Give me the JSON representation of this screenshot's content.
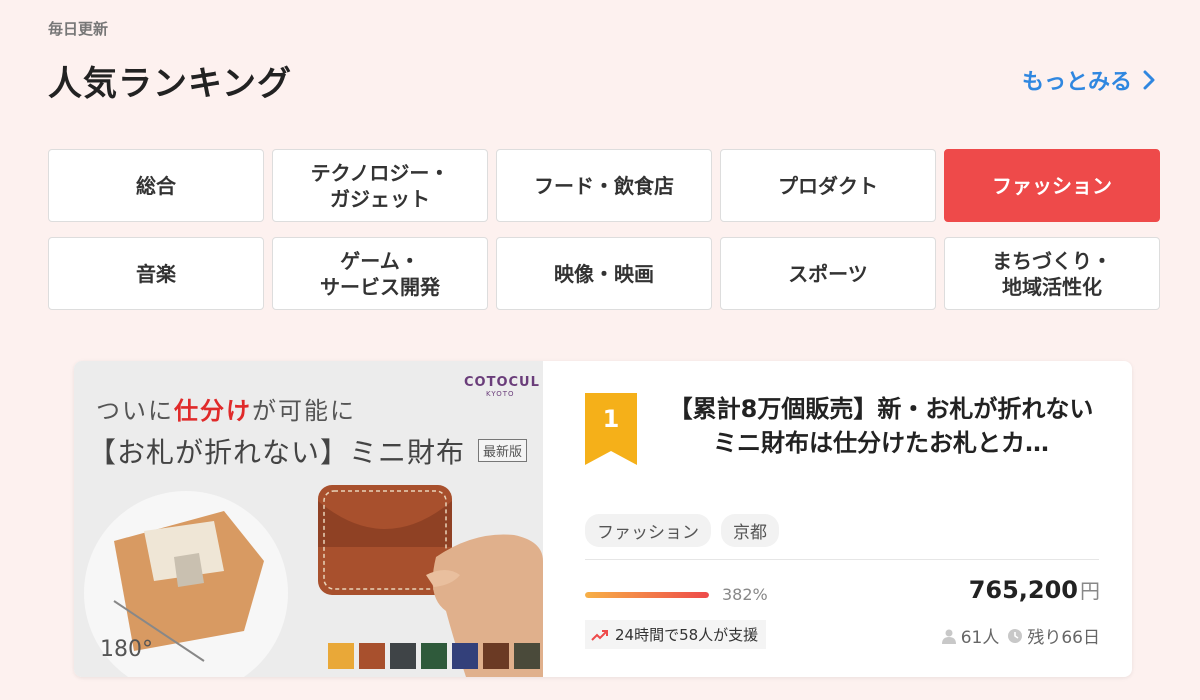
{
  "header": {
    "eyebrow": "毎日更新",
    "title": "人気ランキング",
    "more_label": "もっとみる"
  },
  "categories": [
    {
      "label": "総合",
      "active": false
    },
    {
      "label": "テクノロジー・\nガジェット",
      "active": false
    },
    {
      "label": "フード・飲食店",
      "active": false
    },
    {
      "label": "プロダクト",
      "active": false
    },
    {
      "label": "ファッション",
      "active": true
    },
    {
      "label": "音楽",
      "active": false
    },
    {
      "label": "ゲーム・\nサービス開発",
      "active": false
    },
    {
      "label": "映像・映画",
      "active": false
    },
    {
      "label": "スポーツ",
      "active": false
    },
    {
      "label": "まちづくり・\n地域活性化",
      "active": false
    }
  ],
  "project": {
    "rank": "1",
    "title": "【累計8万個販売】新・お札が折れないミニ財布は仕分けたお札とカ…",
    "tags": [
      "ファッション",
      "京都"
    ],
    "progress_percent": 382,
    "progress_label": "382%",
    "amount": "765,200",
    "currency_unit": "円",
    "trend_text": "24時間で58人が支援",
    "supporters": "61人",
    "remaining": "残り66日",
    "image": {
      "brand": "COTOCUL",
      "brand_sub": "KYOTO",
      "line1_pre": "ついに",
      "line1_hl": "仕分け",
      "line1_post": "が可能に",
      "line2": "【お札が折れない】ミニ財布",
      "badge": "最新版",
      "angle": "180°",
      "swatches": [
        "#e9a838",
        "#a8502d",
        "#3f4447",
        "#2f5a3b",
        "#33407a",
        "#6b3a24",
        "#4a4a3a"
      ]
    }
  },
  "colors": {
    "accent": "#ee4a4a",
    "link": "#2f87e0",
    "rank_badge": "#f5b019"
  }
}
